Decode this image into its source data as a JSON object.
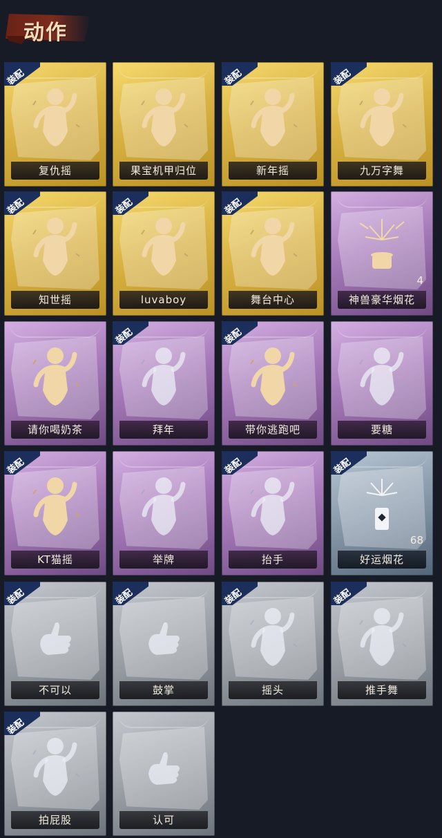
{
  "section_title": "动作",
  "badge_label": "装配",
  "rarity_colors": {
    "gold": "#d9b344",
    "purple": "#a77bba",
    "blue": "#8697a9",
    "gray": "#9ba0a7",
    "badge": "#1c2f5c"
  },
  "cards": [
    {
      "name": "复仇摇",
      "rarity": "gold",
      "equipped": true,
      "icon": "dance-figure-raised-arm-icon"
    },
    {
      "name": "果宝机甲归位",
      "rarity": "gold",
      "equipped": false,
      "icon": "dance-figure-arms-out-icon"
    },
    {
      "name": "新年摇",
      "rarity": "gold",
      "equipped": true,
      "icon": "dance-figure-clap-icon"
    },
    {
      "name": "九万字舞",
      "rarity": "gold",
      "equipped": true,
      "icon": "dance-figure-swirl-icon"
    },
    {
      "name": "知世摇",
      "rarity": "gold",
      "equipped": true,
      "icon": "dance-figure-sway-icon"
    },
    {
      "name": "luvaboy",
      "rarity": "gold",
      "equipped": true,
      "icon": "dance-figure-arms-crossed-icon"
    },
    {
      "name": "舞台中心",
      "rarity": "gold",
      "equipped": true,
      "icon": "dance-figure-pose-icon"
    },
    {
      "name": "神兽豪华烟花",
      "rarity": "purple",
      "equipped": false,
      "icon": "fireworks-icon",
      "count": "4"
    },
    {
      "name": "请你喝奶茶",
      "rarity": "purple",
      "equipped": false,
      "icon": "figure-holding-sign-icon"
    },
    {
      "name": "拜年",
      "rarity": "purple",
      "equipped": true,
      "icon": "figure-bow-icon"
    },
    {
      "name": "带你逃跑吧",
      "rarity": "purple",
      "equipped": true,
      "icon": "figure-running-icon"
    },
    {
      "name": "要糖",
      "rarity": "purple",
      "equipped": false,
      "icon": "figure-reach-icon"
    },
    {
      "name": "KT猫摇",
      "rarity": "purple",
      "equipped": true,
      "icon": "dance-figure-cat-icon"
    },
    {
      "name": "举牌",
      "rarity": "purple",
      "equipped": false,
      "icon": "figure-hold-sign-cat-icon"
    },
    {
      "name": "抬手",
      "rarity": "purple",
      "equipped": true,
      "icon": "figure-raise-hand-icon"
    },
    {
      "name": "好运烟花",
      "rarity": "blue",
      "equipped": true,
      "icon": "firework-can-icon",
      "count": "68"
    },
    {
      "name": "不可以",
      "rarity": "gray",
      "equipped": true,
      "icon": "finger-wag-icon"
    },
    {
      "name": "鼓掌",
      "rarity": "gray",
      "equipped": true,
      "icon": "clapping-hands-icon"
    },
    {
      "name": "摇头",
      "rarity": "gray",
      "equipped": true,
      "icon": "figure-shake-head-icon"
    },
    {
      "name": "推手舞",
      "rarity": "gray",
      "equipped": true,
      "icon": "figure-push-hands-icon"
    },
    {
      "name": "拍屁股",
      "rarity": "gray",
      "equipped": true,
      "icon": "figure-slap-icon"
    },
    {
      "name": "认可",
      "rarity": "gray",
      "equipped": false,
      "icon": "thumbs-up-icon"
    }
  ]
}
